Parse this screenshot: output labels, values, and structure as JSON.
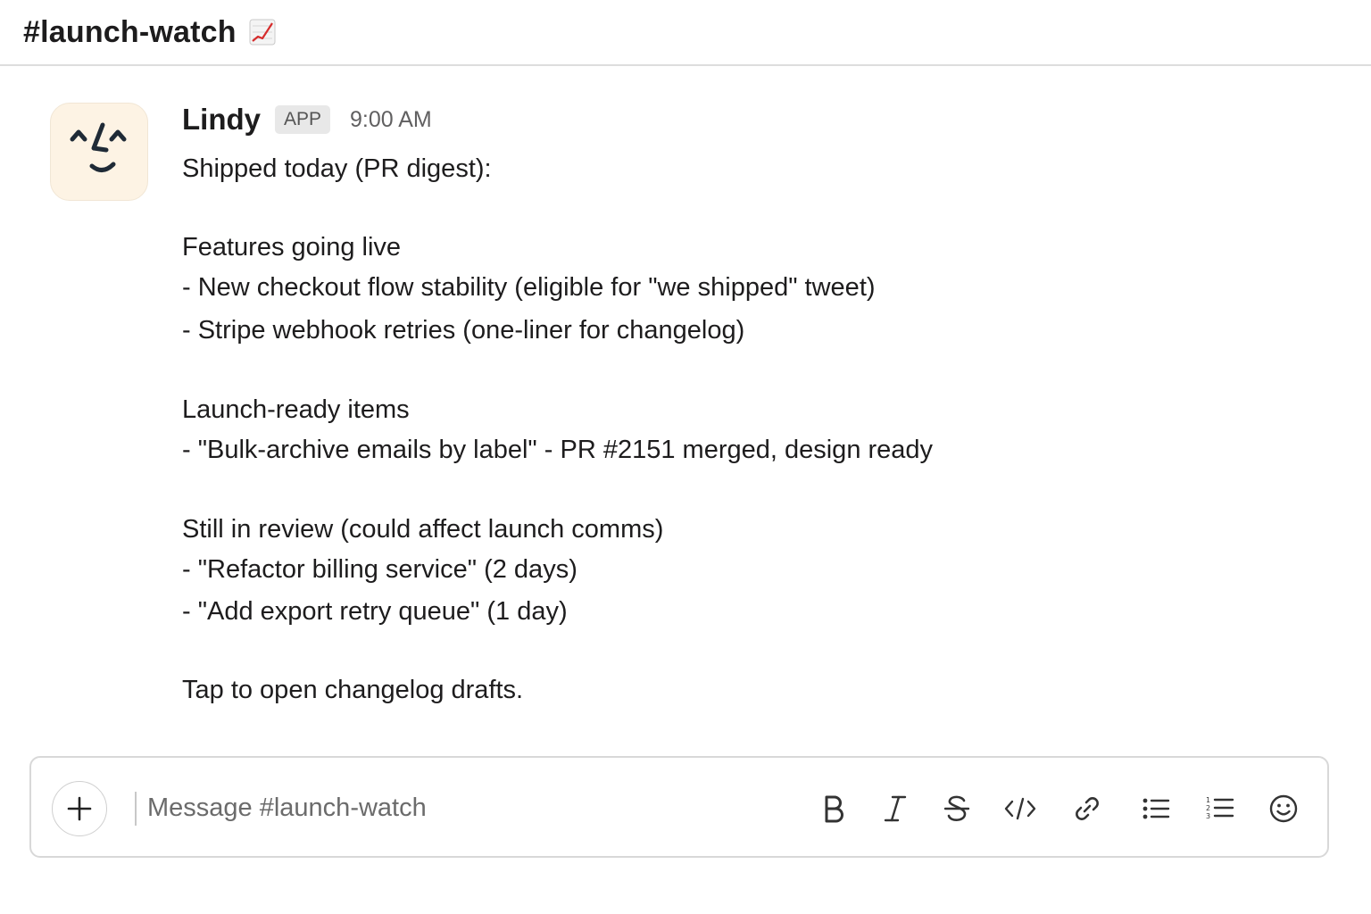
{
  "channel": {
    "title": "#launch-watch",
    "emoji_icon": "chart-increasing-icon"
  },
  "message": {
    "sender": "Lindy",
    "badge": "APP",
    "time": "9:00 AM",
    "lines": [
      "Shipped today (PR digest):",
      "Features going live",
      "- New checkout flow stability (eligible for \"we shipped\" tweet)",
      "- Stripe webhook retries (one-liner for changelog)",
      "Launch-ready items",
      "- \"Bulk-archive emails by label\" - PR #2151 merged, design ready",
      "Still in review (could affect launch comms)",
      "- \"Refactor billing service\" (2 days)",
      "- \"Add export retry queue\" (1 day)",
      "Tap to open changelog drafts."
    ]
  },
  "composer": {
    "placeholder": "Message #launch-watch",
    "tools": [
      "plus-icon",
      "bold-icon",
      "italic-icon",
      "strikethrough-icon",
      "code-icon",
      "link-icon",
      "bulleted-list-icon",
      "numbered-list-icon",
      "emoji-icon"
    ]
  },
  "colors": {
    "avatar_bg": "#fdf3e4",
    "badge_bg": "#e8e8e8",
    "text": "#1d1c1d"
  }
}
